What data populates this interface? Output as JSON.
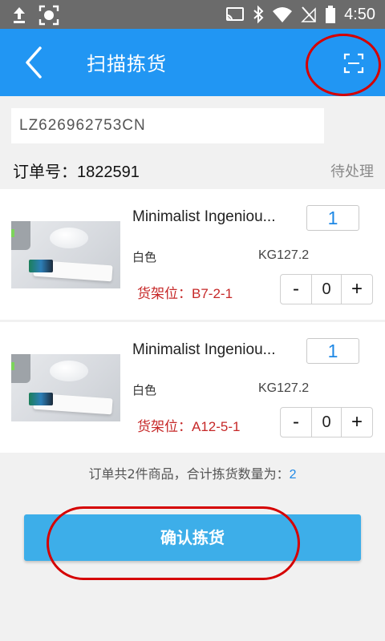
{
  "status_bar": {
    "time": "4:50",
    "icons_left": [
      "upload-icon",
      "screen-record-icon"
    ],
    "icons_right": [
      "cast-icon",
      "bluetooth-icon",
      "wifi-icon",
      "no-sim-icon",
      "battery-icon"
    ]
  },
  "header": {
    "title": "扫描拣货",
    "back_icon": "chevron-left-icon",
    "scan_icon": "scan-frame-icon",
    "background": "#2196f3"
  },
  "tracking": {
    "value": "LZ626962753CN"
  },
  "order": {
    "label": "订单号：",
    "number": "1822591",
    "status": "待处理"
  },
  "products": [
    {
      "name": "Minimalist Ingeniou...",
      "quantity": "1",
      "color": "白色",
      "sku": "KG127.2",
      "location_label": "货架位：",
      "location": "B7-2-1",
      "minus": "-",
      "picked": "0",
      "plus": "+"
    },
    {
      "name": "Minimalist Ingeniou...",
      "quantity": "1",
      "color": "白色",
      "sku": "KG127.2",
      "location_label": "货架位：",
      "location": "A12-5-1",
      "minus": "-",
      "picked": "0",
      "plus": "+"
    }
  ],
  "summary": {
    "text": "订单共2件商品，合计拣货数量为：",
    "value": "2"
  },
  "confirm": {
    "label": "确认拣货",
    "color": "#3daee9"
  },
  "annotation_color": "#d50000"
}
